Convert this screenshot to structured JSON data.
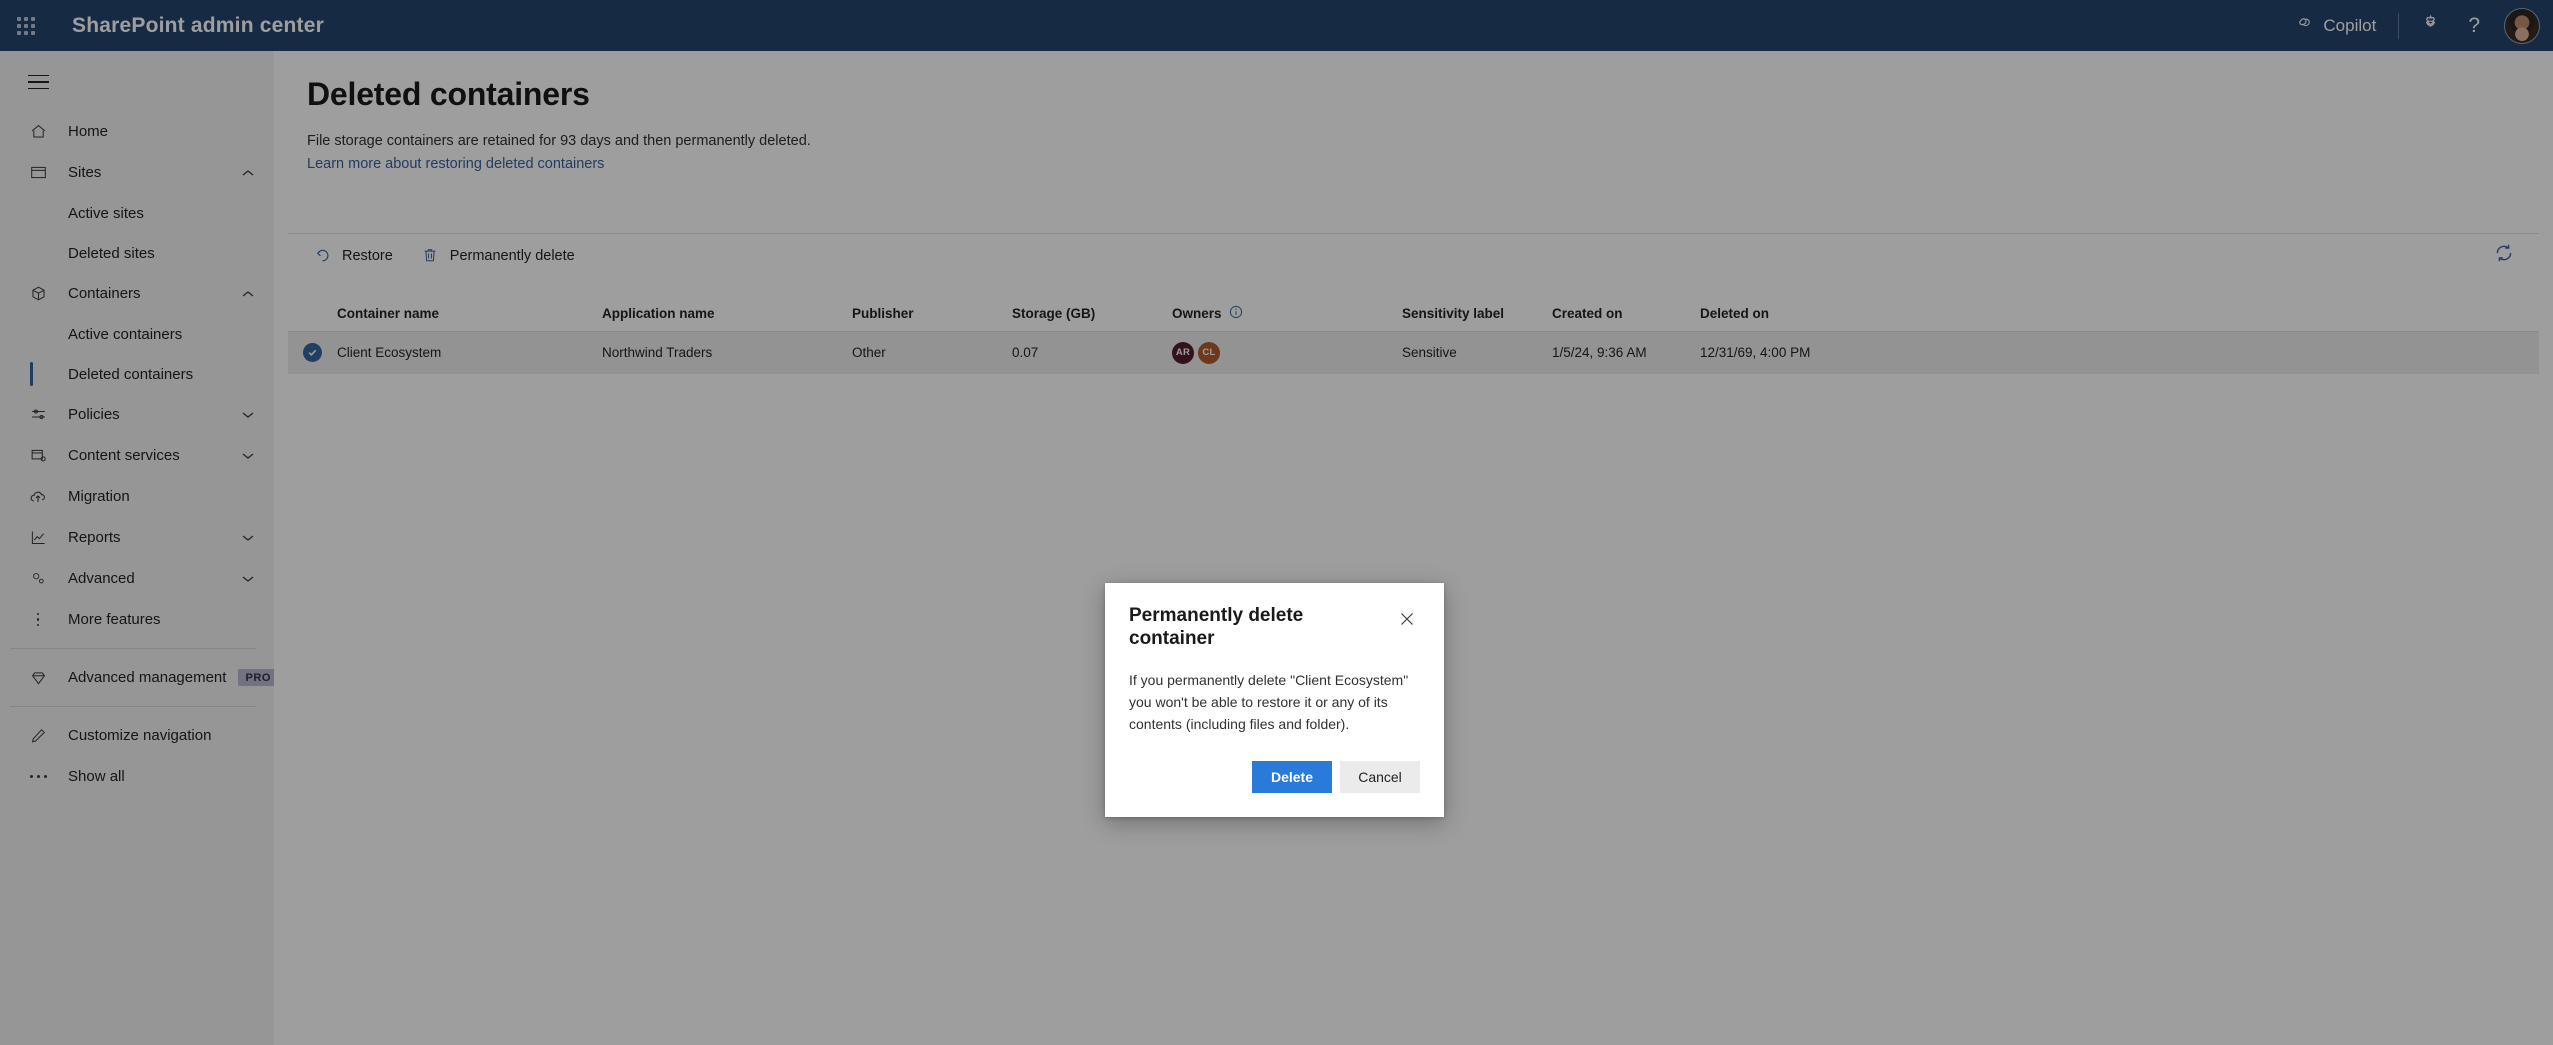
{
  "suite": {
    "waffle_icon": "app-launcher-waffle-icon",
    "title": "SharePoint admin center",
    "copilot_label": "Copilot",
    "copilot_icon": "copilot-icon",
    "settings_icon": "gear-icon",
    "help_label": "?",
    "avatar_alt": "user-avatar"
  },
  "sidebar": {
    "hamburger_icon": "hamburger-menu-icon",
    "items": [
      {
        "label": "Home",
        "icon": "home-icon",
        "type": "item",
        "chevron": ""
      },
      {
        "label": "Sites",
        "icon": "sites-icon",
        "type": "item",
        "chevron": "up"
      },
      {
        "label": "Active sites",
        "type": "sub",
        "selected": false
      },
      {
        "label": "Deleted sites",
        "type": "sub",
        "selected": false
      },
      {
        "label": "Containers",
        "icon": "containers-icon",
        "type": "item",
        "chevron": "up"
      },
      {
        "label": "Active containers",
        "type": "sub",
        "selected": false
      },
      {
        "label": "Deleted containers",
        "type": "sub",
        "selected": true
      },
      {
        "label": "Policies",
        "icon": "policies-icon",
        "type": "item",
        "chevron": "down"
      },
      {
        "label": "Content services",
        "icon": "content-services-icon",
        "type": "item",
        "chevron": "down"
      },
      {
        "label": "Migration",
        "icon": "migration-icon",
        "type": "item",
        "chevron": ""
      },
      {
        "label": "Reports",
        "icon": "reports-icon",
        "type": "item",
        "chevron": "down"
      },
      {
        "label": "Advanced",
        "icon": "advanced-icon",
        "type": "item",
        "chevron": "down"
      },
      {
        "label": "More features",
        "icon": "more-features-icon",
        "type": "item",
        "chevron": ""
      }
    ],
    "advanced_management": {
      "label": "Advanced management",
      "icon": "diamond-icon",
      "badge": "PRO"
    },
    "customize_navigation": {
      "label": "Customize navigation",
      "icon": "pencil-icon"
    },
    "show_all": {
      "label": "Show all",
      "icon": "ellipsis-icon"
    }
  },
  "page": {
    "title": "Deleted containers",
    "description": "File storage containers are retained for 93 days and then permanently deleted.",
    "link": "Learn more about restoring deleted containers"
  },
  "command_bar": {
    "restore": {
      "label": "Restore",
      "icon": "restore-arrow-icon"
    },
    "permanently_delete": {
      "label": "Permanently delete",
      "icon": "trash-icon"
    },
    "refresh": {
      "icon": "refresh-icon"
    }
  },
  "table": {
    "columns": [
      "Container name",
      "Application name",
      "Publisher",
      "Storage (GB)",
      "Owners",
      "Sensitivity label",
      "Created on",
      "Deleted on"
    ],
    "owners_info_icon": "info-icon",
    "rows": [
      {
        "selected": true,
        "container_name": "Client Ecosystem",
        "application_name": "Northwind Traders",
        "publisher": "Other",
        "storage_gb": "0.07",
        "owners": [
          {
            "initials": "AR",
            "color": "#5c1a2e"
          },
          {
            "initials": "CL",
            "color": "#c0591b"
          }
        ],
        "sensitivity_label": "Sensitive",
        "created_on": "1/5/24, 9:36 AM",
        "deleted_on": "12/31/69, 4:00 PM"
      }
    ]
  },
  "dialog": {
    "title": "Permanently delete container",
    "close_icon": "close-icon",
    "body": "If you permanently delete \"Client Ecosystem\" you won't be able to restore it or any of its contents (including files and folder).",
    "primary_label": "Delete",
    "secondary_label": "Cancel"
  },
  "colors": {
    "suite_header": "#1f4477",
    "accent": "#2f62ad",
    "primary_button": "#2a7ad9",
    "selected_bar": "#2f62ad"
  }
}
